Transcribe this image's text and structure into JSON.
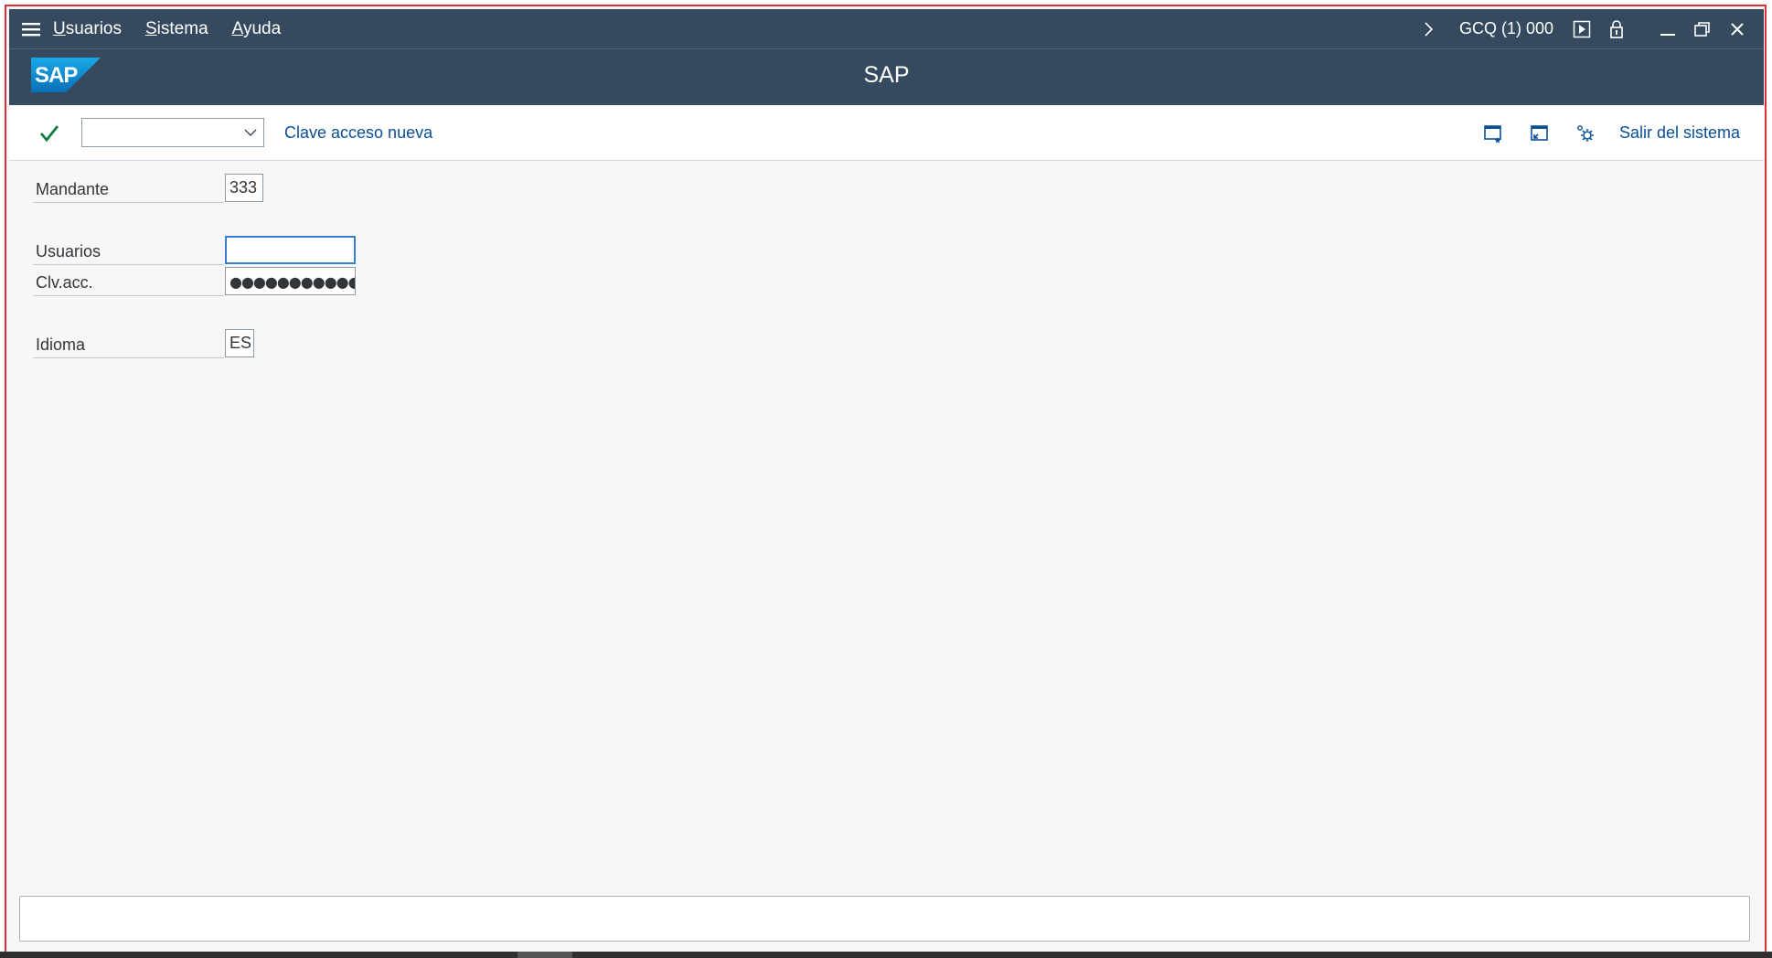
{
  "menubar": {
    "items": [
      {
        "label": "Usuarios",
        "accel": "U",
        "rest": "suarios"
      },
      {
        "label": "Sistema",
        "accel": "S",
        "rest": "istema"
      },
      {
        "label": "Ayuda",
        "accel": "A",
        "rest": "yuda"
      }
    ],
    "system_info": "GCQ (1) 000"
  },
  "titlebar": {
    "logo_text": "SAP",
    "title": "SAP"
  },
  "toolbar": {
    "okcode_value": "",
    "new_password_label": "Clave acceso nueva",
    "logoff_label": "Salir del sistema"
  },
  "form": {
    "client": {
      "label": "Mandante",
      "value": "333"
    },
    "user": {
      "label": "Usuarios",
      "value": ""
    },
    "password": {
      "label": "Clv.acc.",
      "value": "●●●●●●●●●●●●●"
    },
    "language": {
      "label": "Idioma",
      "value": "ES"
    }
  },
  "statusbar": {
    "message": ""
  },
  "colors": {
    "shell": "#354a5f",
    "link": "#0a4f96",
    "check": "#107e3e",
    "frame_border": "#d9303a",
    "focus": "#3a7cd0"
  }
}
